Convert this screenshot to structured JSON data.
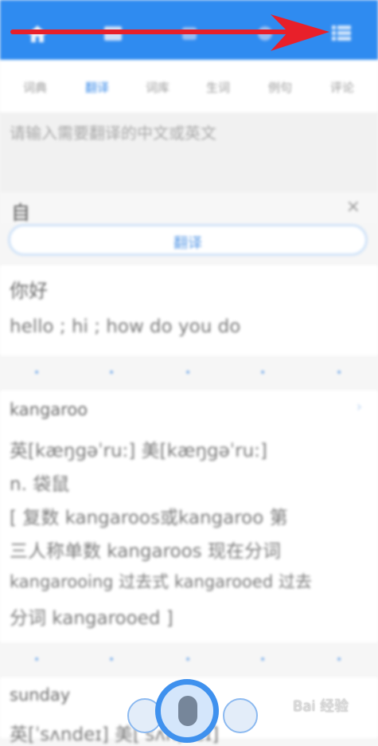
{
  "header": {
    "icons": [
      "home-icon",
      "book-icon",
      "tag-icon",
      "chat-icon",
      "list-icon"
    ],
    "accent_color": "#2f8bf0"
  },
  "tabs": [
    {
      "label": "词典"
    },
    {
      "label": "翻译"
    },
    {
      "label": "词库"
    },
    {
      "label": "生词"
    },
    {
      "label": "例句"
    },
    {
      "label": "评论"
    }
  ],
  "input": {
    "placeholder": "请输入需要翻译的中文或英文"
  },
  "language": {
    "label": "自",
    "close": "×"
  },
  "translate_button": {
    "label": "翻译"
  },
  "results": [
    {
      "word": "你好",
      "lines": [
        "hello ; hi ; how do you do"
      ]
    },
    {
      "word": "kangaroo",
      "lines": [
        "英[kæŋgəˈru:] 美[kæŋgəˈru:]",
        "n. 袋鼠",
        "[ 复数 kangaroos或kangaroo 第",
        "三人称单数 kangaroos 现在分词",
        "kangarooing 过去式 kangarooed 过去",
        "分词 kangarooed ]"
      ]
    },
    {
      "word": "sunday",
      "lines": [
        "英[ˈsʌndeɪ] 美[ˈsʌnˌdeɪ]"
      ]
    }
  ],
  "watermark": "Bai 经验"
}
